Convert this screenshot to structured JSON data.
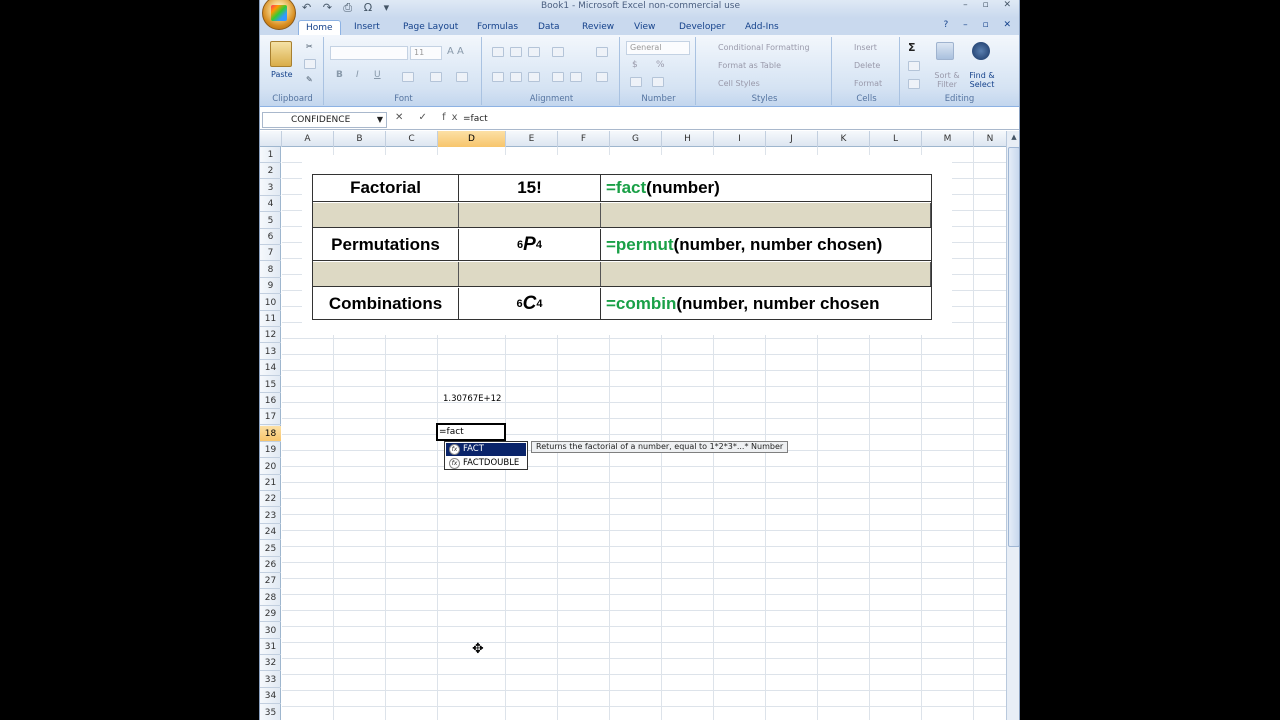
{
  "window": {
    "title": "Book1 - Microsoft Excel non-commercial use",
    "controls": "– ▫ ✕"
  },
  "quick_access": "↶ ↷ ⎙ Ω ▾",
  "tabs": [
    "Home",
    "Insert",
    "Page Layout",
    "Formulas",
    "Data",
    "Review",
    "View",
    "Developer",
    "Add-Ins"
  ],
  "tabs_right": "? – ▫ ✕",
  "ribbon": {
    "clipboard": {
      "label": "Clipboard",
      "paste": "Paste"
    },
    "font": {
      "label": "Font",
      "size": "11",
      "bold": "B",
      "italic": "I",
      "underline": "U"
    },
    "alignment": {
      "label": "Alignment"
    },
    "number": {
      "label": "Number",
      "format": "General",
      "currency": "$",
      "percent": "%"
    },
    "styles": {
      "label": "Styles",
      "conditional": "Conditional Formatting",
      "format_table": "Format as Table",
      "cell_styles": "Cell Styles"
    },
    "cells": {
      "label": "Cells",
      "insert": "Insert",
      "delete": "Delete",
      "format": "Format"
    },
    "editing": {
      "label": "Editing",
      "sigma": "Σ",
      "sort": "Sort & Filter",
      "find": "Find & Select"
    }
  },
  "formula_bar": {
    "name_box": "CONFIDENCE",
    "buttons": "✕ ✓ fx",
    "formula": "=fact"
  },
  "columns": [
    "A",
    "B",
    "C",
    "D",
    "E",
    "F",
    "G",
    "H",
    "I",
    "J",
    "K",
    "L",
    "M",
    "N"
  ],
  "selected_column": "D",
  "selected_row": 18,
  "rows": [
    1,
    2,
    3,
    4,
    5,
    6,
    7,
    8,
    9,
    10,
    11,
    12,
    13,
    14,
    15,
    16,
    17,
    18,
    19,
    20,
    21,
    22,
    23,
    24,
    25,
    26,
    27,
    28,
    29,
    30,
    31,
    32,
    33,
    34,
    35
  ],
  "table": {
    "row1": {
      "label": "Factorial",
      "symbol": "15!",
      "fn": "=fact",
      "args": "(number)"
    },
    "row2": {
      "label": "Permutations",
      "sub_n": "6",
      "letter": "P",
      "sub_r": "4",
      "fn": "=permut",
      "args": "(number, number chosen)"
    },
    "row3": {
      "label": "Combinations",
      "sub_n": "6",
      "letter": "C",
      "sub_r": "4",
      "fn": "=combin",
      "args": "(number, number chosen"
    }
  },
  "cell_d16": "1.30767E+12",
  "active_cell_text": "=fact",
  "autocomplete": {
    "items": [
      "FACT",
      "FACTDOUBLE"
    ],
    "icon": "fx",
    "tooltip": "Returns the factorial of a number, equal to 1*2*3*...* Number"
  },
  "cursor": "✥"
}
